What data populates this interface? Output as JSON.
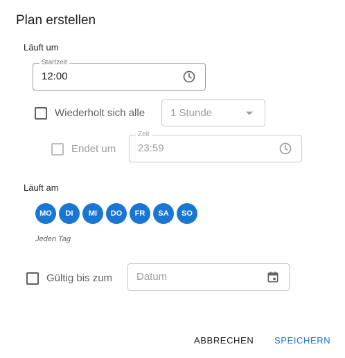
{
  "dialog": {
    "title": "Plan erstellen"
  },
  "runs_at": {
    "label": "Läuft um",
    "start_time": {
      "label": "Startzeit",
      "value": "12:00",
      "icon": "clock-icon"
    },
    "repeat": {
      "label": "Wiederholt sich alle",
      "checked": false,
      "interval_value": "1 Stunde",
      "dropdown_icon": "caret-down-icon"
    },
    "ends": {
      "label": "Endet um",
      "checked": false
    },
    "end_time": {
      "label": "Zeit",
      "value": "23:59",
      "icon": "clock-icon"
    }
  },
  "runs_on": {
    "label": "Läuft am",
    "days": [
      "MO",
      "DI",
      "MI",
      "DO",
      "FR",
      "SA",
      "SO"
    ],
    "summary": "Jeden Tag"
  },
  "valid_until": {
    "label": "Gültig bis zum",
    "checked": false,
    "date_placeholder": "Datum",
    "icon": "calendar-icon"
  },
  "actions": {
    "cancel_label": "ABBRECHEN",
    "save_label": "SPEICHERN"
  },
  "colors": {
    "accent": "#1976d2",
    "text": "#212121",
    "muted": "#9e9e9e"
  }
}
